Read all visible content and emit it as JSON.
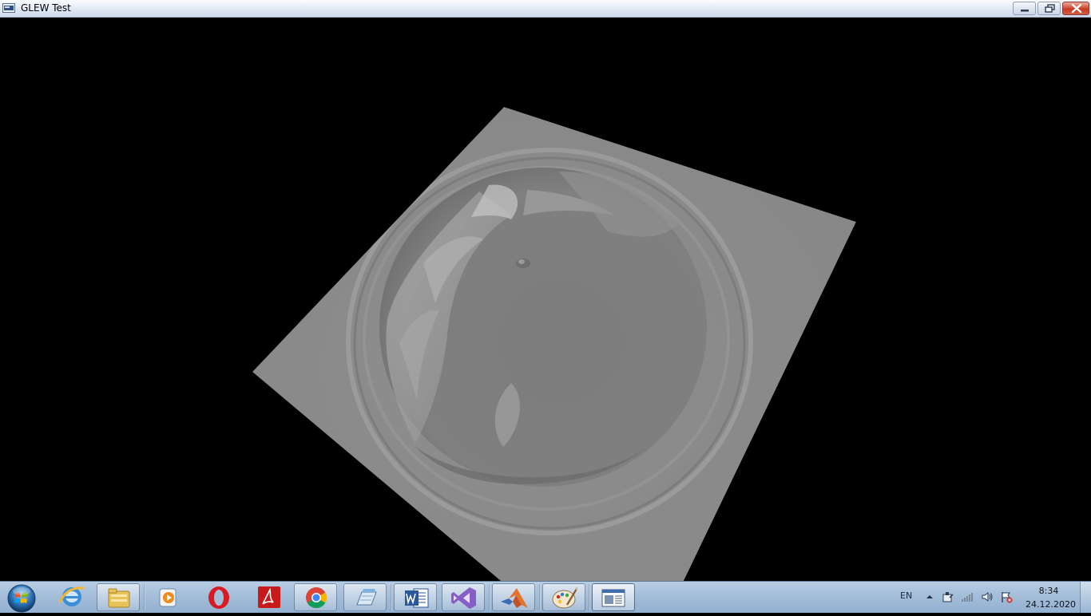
{
  "window": {
    "title": "GLEW Test"
  },
  "viewport": {
    "description_colors": {
      "background": "#000000",
      "surface": "#8a8a8a"
    }
  },
  "taskbar": {
    "pinned": [
      {
        "name": "internet-explorer-icon"
      },
      {
        "name": "file-explorer-icon"
      },
      {
        "name": "media-player-icon"
      },
      {
        "name": "opera-icon"
      },
      {
        "name": "acrobat-reader-icon"
      },
      {
        "name": "chrome-icon"
      },
      {
        "name": "notepad-icon"
      },
      {
        "name": "word-icon"
      },
      {
        "name": "visual-studio-icon"
      },
      {
        "name": "matlab-icon"
      },
      {
        "name": "paint-icon"
      },
      {
        "name": "glew-test-app-icon"
      }
    ],
    "tray": {
      "language": "EN",
      "time": "8:34",
      "date": "24.12.2020"
    }
  }
}
